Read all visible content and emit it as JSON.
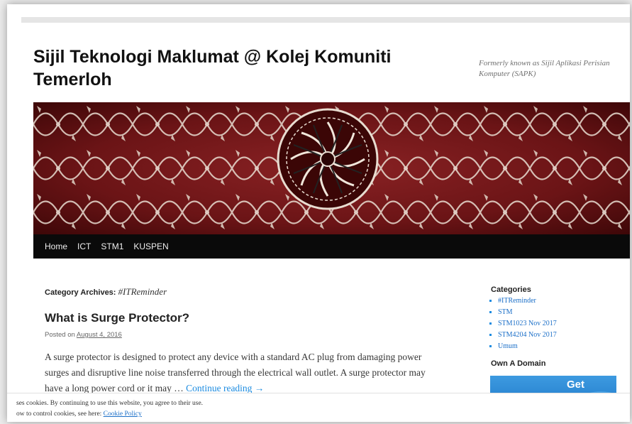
{
  "site": {
    "title": "Sijil Teknologi Maklumat @ Kolej Komuniti Temerloh",
    "description": "Formerly known as Sijil Aplikasi Perisian Komputer (SAPK)"
  },
  "nav": {
    "items": [
      "Home",
      "ICT",
      "STM1",
      "KUSPEN"
    ]
  },
  "archive": {
    "label": "Category Archives:",
    "category": "#ITReminder"
  },
  "post": {
    "title": "What is Surge Protector?",
    "posted_on_label": "Posted on",
    "date": "August 4, 2016",
    "excerpt": "A surge protector is designed to protect any device with a standard AC plug from damaging power surges and disruptive line noise transferred through the electrical wall outlet. A surge protector may have a long power cord or it may …",
    "continue_label": "Continue reading →"
  },
  "sidebar": {
    "categories_title": "Categories",
    "categories": [
      "#ITReminder",
      "STM",
      "STM1023 Nov 2017",
      "STM4204 Nov 2017",
      "Umum"
    ],
    "domain_title": "Own A Domain",
    "domain_button": "Get"
  },
  "cookie": {
    "line1": "ses cookies. By continuing to use this website, you agree to their use.",
    "line2_prefix": "ow to control cookies, see here:",
    "policy_link": "Cookie Policy"
  },
  "colors": {
    "link": "#1b8be0",
    "nav_bg": "#0a0a0a",
    "banner_bg": "#5e0f10"
  }
}
